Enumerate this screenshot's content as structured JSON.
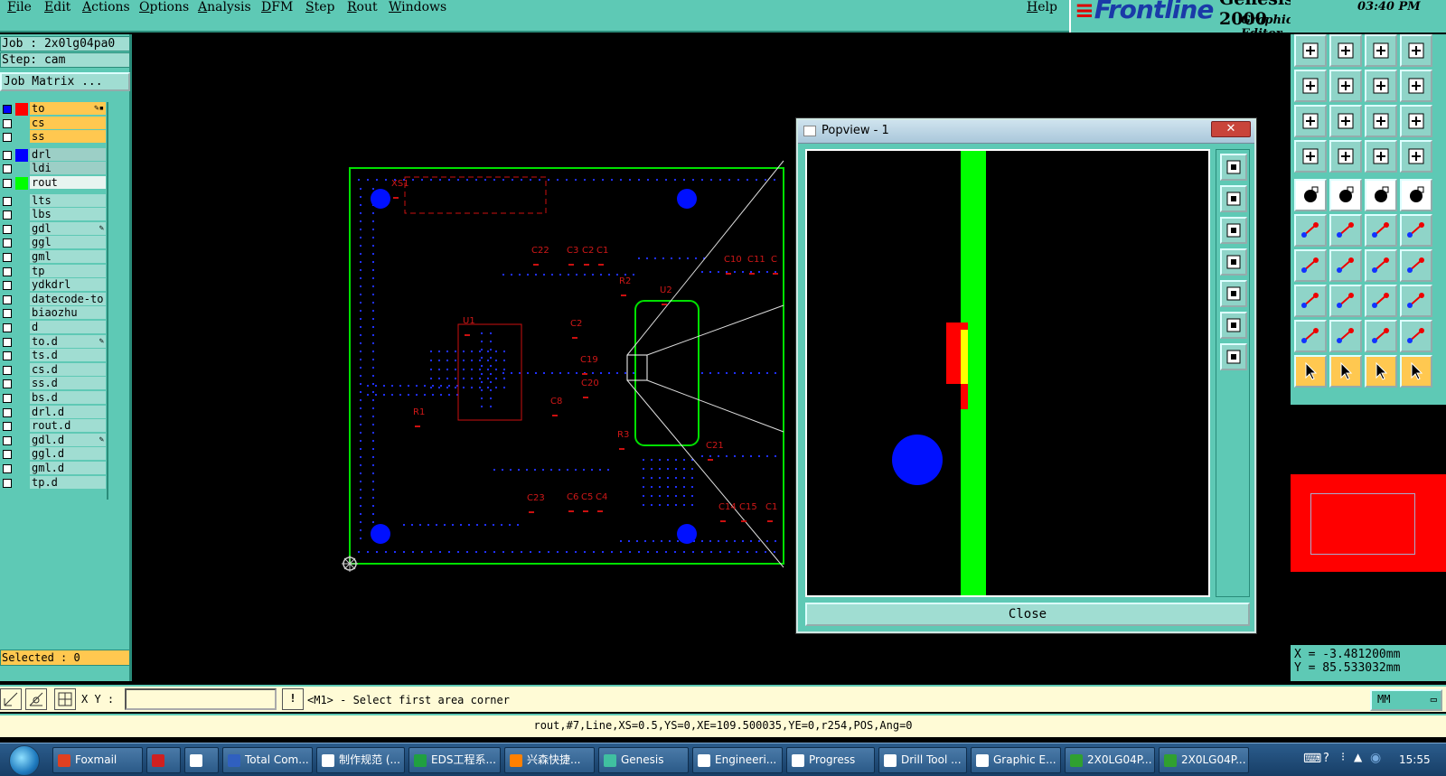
{
  "menu": {
    "items": [
      "File",
      "Edit",
      "Actions",
      "Options",
      "Analysis",
      "DFM",
      "Step",
      "Rout",
      "Windows"
    ],
    "help": "Help"
  },
  "brand": {
    "company": "Frontline",
    "product": "Genesis 2000",
    "subtitle": "Graphic Editor"
  },
  "clock": "03:40 PM",
  "job": {
    "job_label": "Job : 2x0lg04pa0",
    "step_label": "Step: cam",
    "matrix_button": "Job Matrix ..."
  },
  "layers": [
    {
      "name": "to",
      "color": "#ff0000",
      "type": "board",
      "checked": true,
      "mark": "✎▪"
    },
    {
      "name": "cs",
      "color": "",
      "type": "board",
      "checked": false,
      "mark": ""
    },
    {
      "name": "ss",
      "color": "",
      "type": "board",
      "checked": false,
      "mark": ""
    },
    {
      "name": "drl",
      "color": "#0000ff",
      "type": "drill",
      "checked": false,
      "mark": ""
    },
    {
      "name": "ldi",
      "color": "",
      "type": "drill",
      "checked": false,
      "mark": ""
    },
    {
      "name": "rout",
      "color": "#00ff00",
      "type": "rout",
      "checked": false,
      "mark": ""
    },
    {
      "name": "lts",
      "color": "",
      "type": "misc",
      "checked": false,
      "mark": ""
    },
    {
      "name": "lbs",
      "color": "",
      "type": "misc",
      "checked": false,
      "mark": ""
    },
    {
      "name": "gdl",
      "color": "",
      "type": "misc",
      "checked": false,
      "mark": "✎"
    },
    {
      "name": "ggl",
      "color": "",
      "type": "misc",
      "checked": false,
      "mark": ""
    },
    {
      "name": "gml",
      "color": "",
      "type": "misc",
      "checked": false,
      "mark": ""
    },
    {
      "name": "tp",
      "color": "",
      "type": "misc",
      "checked": false,
      "mark": ""
    },
    {
      "name": "ydkdrl",
      "color": "",
      "type": "misc",
      "checked": false,
      "mark": ""
    },
    {
      "name": "datecode-to",
      "color": "",
      "type": "misc",
      "checked": false,
      "mark": ""
    },
    {
      "name": "biaozhu",
      "color": "",
      "type": "misc",
      "checked": false,
      "mark": ""
    },
    {
      "name": "d",
      "color": "",
      "type": "misc",
      "checked": false,
      "mark": ""
    },
    {
      "name": "to.d",
      "color": "",
      "type": "misc",
      "checked": false,
      "mark": "✎"
    },
    {
      "name": "ts.d",
      "color": "",
      "type": "misc",
      "checked": false,
      "mark": ""
    },
    {
      "name": "cs.d",
      "color": "",
      "type": "misc",
      "checked": false,
      "mark": ""
    },
    {
      "name": "ss.d",
      "color": "",
      "type": "misc",
      "checked": false,
      "mark": ""
    },
    {
      "name": "bs.d",
      "color": "",
      "type": "misc",
      "checked": false,
      "mark": ""
    },
    {
      "name": "drl.d",
      "color": "",
      "type": "misc",
      "checked": false,
      "mark": ""
    },
    {
      "name": "rout.d",
      "color": "",
      "type": "misc",
      "checked": false,
      "mark": ""
    },
    {
      "name": "gdl.d",
      "color": "",
      "type": "misc",
      "checked": false,
      "mark": "✎"
    },
    {
      "name": "ggl.d",
      "color": "",
      "type": "misc",
      "checked": false,
      "mark": ""
    },
    {
      "name": "gml.d",
      "color": "",
      "type": "misc",
      "checked": false,
      "mark": ""
    },
    {
      "name": "tp.d",
      "color": "",
      "type": "misc",
      "checked": false,
      "mark": ""
    }
  ],
  "selected": "Selected : 0",
  "pcb": {
    "labels": [
      "XS1",
      "C22",
      "C3",
      "C2",
      "C1",
      "R2",
      "U2",
      "C10",
      "C11",
      "C",
      "U1",
      "C2",
      "C19",
      "C20",
      "C8",
      "R1",
      "R3",
      "C21",
      "C23",
      "C6",
      "C5",
      "C4",
      "C14",
      "C15",
      "C1"
    ],
    "colors": {
      "outline": "#00e000",
      "parts": "#cc1010",
      "drill": "#0000ff"
    }
  },
  "popview": {
    "title": "Popview - 1",
    "close_x": "✕",
    "close_button": "Close",
    "tools": [
      "fit-icon",
      "up-icon",
      "down-icon",
      "left-icon",
      "right-icon",
      "zoom-out-icon",
      "zoom-home-icon"
    ]
  },
  "right_tools": [
    "page-up-icon",
    "page-down-icon",
    "home-icon",
    "window-icon",
    "page-left-icon",
    "page-right-icon",
    "scale-icon",
    "fit-window-icon",
    "zoom-box-icon",
    "pan-icon",
    "ratio-icon",
    "help-icon",
    "settings-icon",
    "probe-icon",
    "snap-icon",
    "snap-grid-icon",
    "pad-icon",
    "line-icon",
    "measure-icon",
    "circle-icon",
    "node-icon",
    "cross-icon",
    "move-icon",
    "stretch-icon",
    "angle-icon",
    "line-draw-icon",
    "arc-icon",
    "mirror-icon",
    "copy-icon",
    "dash-icon",
    "center-icon",
    "resize-icon",
    "triangle-icon",
    "poly-icon",
    "arch-icon",
    "bridge-icon",
    "select-icon",
    "select-box-icon",
    "select-poly-icon",
    "select-net-icon"
  ],
  "coords": {
    "x": "X = -3.481200mm",
    "y": "Y = 85.533032mm"
  },
  "command": {
    "xy_label": "X Y :",
    "xy_value": "",
    "prompt": "<M1> - Select first area corner",
    "units": "MM"
  },
  "status": "rout,#7,Line,XS=0.5,YS=0,XE=109.500035,YE=0,r254,POS,Ang=0",
  "taskbar": {
    "tasks": [
      {
        "label": "Foxmail",
        "icon_color": "#e04020"
      },
      {
        "label": "",
        "icon_color": "#d02020"
      },
      {
        "label": "",
        "icon_color": "#ffffff"
      },
      {
        "label": "Total Com...",
        "icon_color": "#3060c0"
      },
      {
        "label": "制作规范 (...",
        "icon_color": "#ffffff"
      },
      {
        "label": "EDS工程系...",
        "icon_color": "#20a040"
      },
      {
        "label": "兴森快捷...",
        "icon_color": "#ff8000"
      },
      {
        "label": "Genesis",
        "icon_color": "#40c0a0"
      },
      {
        "label": "Engineeri...",
        "icon_color": "#ffffff"
      },
      {
        "label": "Progress",
        "icon_color": "#ffffff"
      },
      {
        "label": "Drill Tool ...",
        "icon_color": "#ffffff"
      },
      {
        "label": "Graphic E...",
        "icon_color": "#ffffff"
      },
      {
        "label": "2X0LG04P...",
        "icon_color": "#30a030"
      },
      {
        "label": "2X0LG04P...",
        "icon_color": "#30a030"
      }
    ],
    "time": "15:55"
  }
}
